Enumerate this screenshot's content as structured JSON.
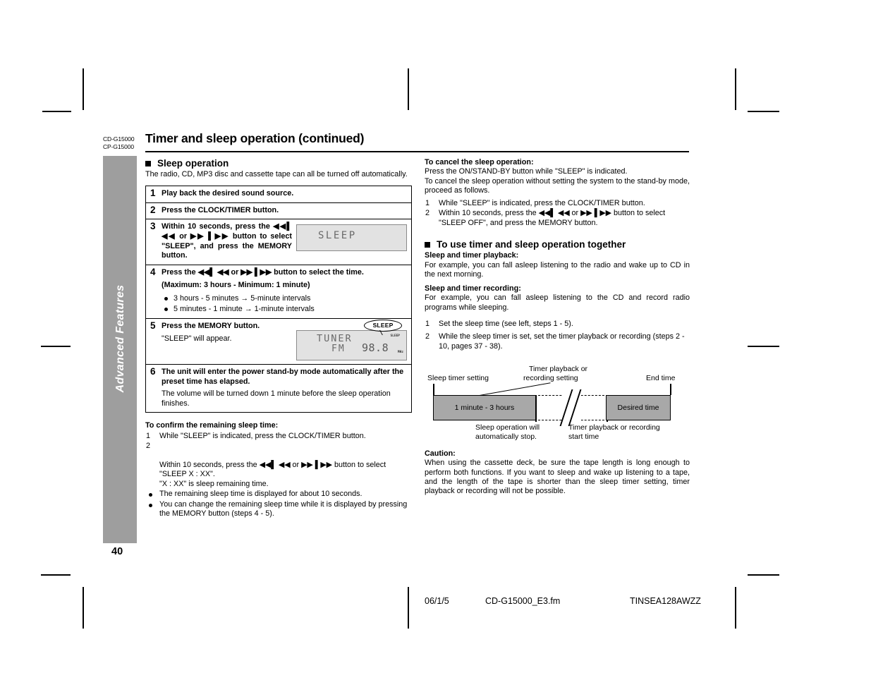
{
  "header": {
    "model_codes": [
      "CD-G15000",
      "CP-G15000"
    ],
    "title": "Timer and sleep operation (continued)"
  },
  "sidebar": {
    "tab_label": "Advanced Features",
    "page_number": "40"
  },
  "left_column": {
    "section_heading": "Sleep operation",
    "intro": "The radio, CD, MP3 disc and cassette tape can all be turned off automatically.",
    "steps": [
      {
        "number": "1",
        "title": "Play back the desired sound source."
      },
      {
        "number": "2",
        "title": "Press the CLOCK/TIMER button."
      },
      {
        "number": "3",
        "title": "Within 10 seconds, press the ◀◀▌ ◀◀ or ▶▶ ▌▶▶ button to select \"SLEEP\", and press the MEMORY button.",
        "lcd": {
          "type": "sleep-display",
          "text": "SLEEP"
        }
      },
      {
        "number": "4",
        "title": "Press the ◀◀▌ ◀◀ or ▶▶ ▌▶▶ button to select the time.",
        "subtitle": "(Maximum: 3 hours - Minimum: 1 minute)",
        "bullets": [
          "3 hours - 5 minutes → 5-minute intervals",
          "5 minutes - 1 minute → 1-minute intervals"
        ]
      },
      {
        "number": "5",
        "title": "Press the MEMORY button.",
        "note": "\"SLEEP\" will appear.",
        "lcd": {
          "type": "tuner-display",
          "callout": "SLEEP",
          "indicator": "SLEEP",
          "line1": "TUNER",
          "line2": "FM",
          "freq": "98.8",
          "unit": "MHz"
        }
      },
      {
        "number": "6",
        "title": "The unit will enter the power stand-by mode automatically after the preset time has elapsed.",
        "note": "The volume will be turned down 1 minute before the sleep operation finishes."
      }
    ],
    "confirm": {
      "heading": "To confirm the remaining sleep time:",
      "numbered": [
        {
          "n": "1",
          "text": "While \"SLEEP\" is indicated, press the CLOCK/TIMER button."
        },
        {
          "n": "2",
          "text": "Within 10 seconds, press the ◀◀▌ ◀◀ or ▶▶ ▌▶▶ button to select \"SLEEP X : XX\".\n\"X : XX\" is sleep remaining time."
        }
      ],
      "bullets": [
        "The remaining sleep time is displayed for about 10 seconds.",
        "You can change the remaining sleep time while it is displayed by pressing the MEMORY button (steps 4 - 5)."
      ]
    }
  },
  "right_column": {
    "cancel": {
      "heading": "To cancel the sleep operation:",
      "paragraph1": "Press the ON/STAND-BY button while \"SLEEP\" is indicated.",
      "paragraph2": "To cancel the sleep operation without setting the system to the stand-by mode, proceed as follows.",
      "numbered": [
        {
          "n": "1",
          "text": "While \"SLEEP\" is indicated, press the CLOCK/TIMER button."
        },
        {
          "n": "2",
          "text": "Within 10 seconds, press the ◀◀▌ ◀◀ or ▶▶ ▌▶▶ button to select \"SLEEP OFF\", and press the MEMORY button."
        }
      ]
    },
    "together": {
      "section_heading": "To use timer and sleep operation together",
      "playback_heading": "Sleep and timer playback:",
      "playback_text": "For example, you can fall asleep listening to the radio and wake up to CD in the next morning.",
      "recording_heading": "Sleep and timer recording:",
      "recording_text": "For example, you can fall asleep listening to the CD and record radio programs while sleeping.",
      "numbered": [
        {
          "n": "1",
          "text": "Set the sleep time (see left, steps 1 - 5)."
        },
        {
          "n": "2",
          "text": "While the sleep timer is set, set the timer playback or recording (steps 2 - 10, pages 37 - 38)."
        }
      ]
    },
    "diagram": {
      "label_sleep_timer_setting": "Sleep timer setting",
      "label_timer_playback_line1": "Timer playback or",
      "label_timer_playback_line2": "recording setting",
      "label_end_time": "End time",
      "bar1_text": "1 minute - 3 hours",
      "bar2_text": "Desired time",
      "label_stop_line1": "Sleep operation will",
      "label_stop_line2": "automatically stop.",
      "label_start_line1": "Timer playback or recording",
      "label_start_line2": "start time"
    },
    "caution": {
      "heading": "Caution:",
      "text": "When using the cassette deck, be sure the tape length is long enough to perform both functions. If you want to sleep and wake up listening to a tape, and the length of the tape is shorter than the sleep timer setting, timer playback or recording will not be possible."
    }
  },
  "footer": {
    "date": "06/1/5",
    "filename": "CD-G15000_E3.fm",
    "doc_code": "TINSEA128AWZZ"
  },
  "colors": {
    "sidebar_gray": "#9e9e9e",
    "bar_gray": "#a8a8a8",
    "lcd_gray": "#e2e2e2"
  }
}
